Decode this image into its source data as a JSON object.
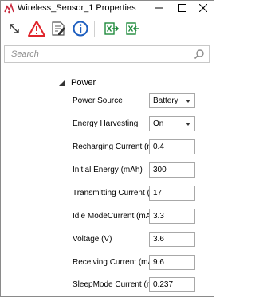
{
  "window": {
    "title": "Wireless_Sensor_1 Properties",
    "icons": {
      "app": "app-logo-icon",
      "minimize": "minimize-icon",
      "maximize": "maximize-icon",
      "close": "close-icon"
    }
  },
  "toolbar": {
    "icons": [
      "expand-arrows-icon",
      "warning-icon",
      "edit-document-icon",
      "info-icon",
      "export-excel-icon",
      "import-excel-icon"
    ]
  },
  "search": {
    "placeholder": "Search",
    "icon": "search-icon"
  },
  "group": {
    "label": "Power",
    "expanded": true
  },
  "properties": [
    {
      "label": "Power Source",
      "value": "Battery",
      "type": "select"
    },
    {
      "label": "Energy Harvesting",
      "value": "On",
      "type": "select"
    },
    {
      "label": "Recharging Current (mA)",
      "value": "0.4",
      "type": "text"
    },
    {
      "label": "Initial Energy (mAh)",
      "value": "300",
      "type": "text"
    },
    {
      "label": "Transmitting Current (mA)",
      "value": "17",
      "type": "text"
    },
    {
      "label": "Idle ModeCurrent (mA)",
      "value": "3.3",
      "type": "text"
    },
    {
      "label": "Voltage (V)",
      "value": "3.6",
      "type": "text"
    },
    {
      "label": "Receiving Current (mA)",
      "value": "9.6",
      "type": "text"
    },
    {
      "label": "SleepMode Current (mA)",
      "value": "0.237",
      "type": "text"
    }
  ],
  "colors": {
    "warning_red": "#e0242b",
    "info_blue": "#1f5fbf",
    "excel_green": "#1e8a3c"
  }
}
